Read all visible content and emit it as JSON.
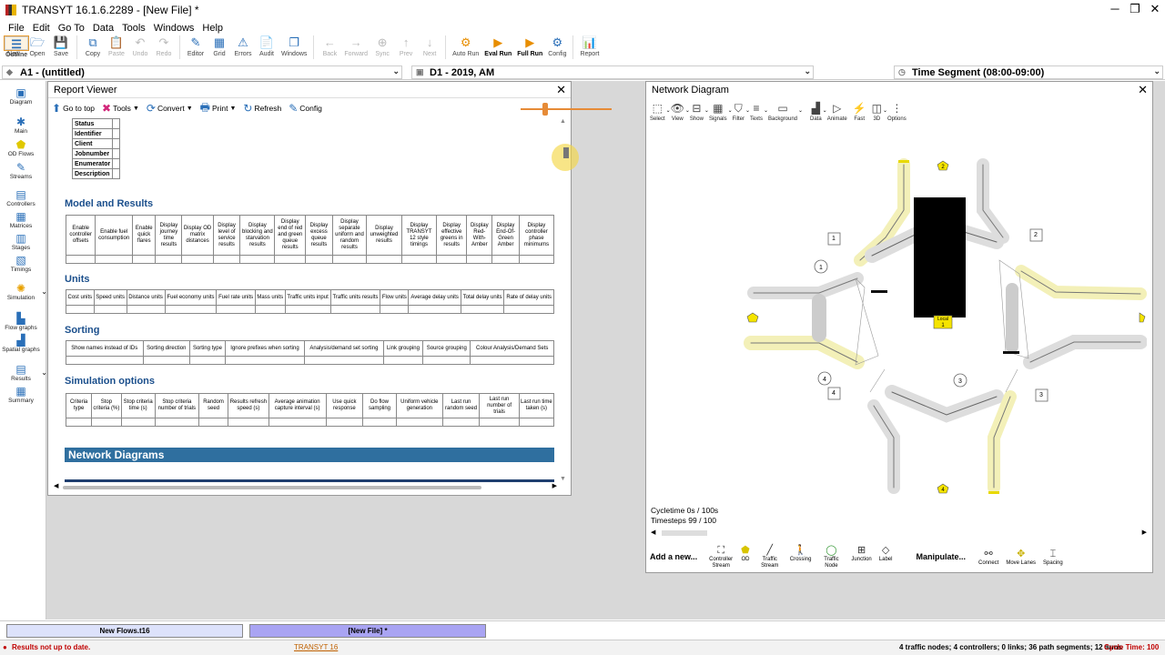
{
  "window": {
    "title": "TRANSYT 16.1.6.2289 - [New File] *"
  },
  "menu": [
    "File",
    "Edit",
    "Go To",
    "Data",
    "Tools",
    "Windows",
    "Help"
  ],
  "toolbar": [
    {
      "label": "New",
      "icon": "new-file-icon",
      "glyph": "🗋",
      "state": "normal"
    },
    {
      "label": "Open",
      "icon": "open-folder-icon",
      "glyph": "🗁",
      "state": "normal"
    },
    {
      "label": "Save",
      "icon": "save-icon",
      "glyph": "💾",
      "state": "normal"
    },
    {
      "label": "Copy",
      "icon": "copy-icon",
      "glyph": "⧉",
      "state": "normal"
    },
    {
      "label": "Paste",
      "icon": "paste-icon",
      "glyph": "📋",
      "state": "disabled"
    },
    {
      "label": "Undo",
      "icon": "undo-icon",
      "glyph": "↶",
      "state": "disabled"
    },
    {
      "label": "Redo",
      "icon": "redo-icon",
      "glyph": "↷",
      "state": "disabled"
    },
    {
      "label": "Outline",
      "icon": "outline-icon",
      "glyph": "☰",
      "state": "selected"
    },
    {
      "label": "Editor",
      "icon": "editor-icon",
      "glyph": "✎",
      "state": "normal"
    },
    {
      "label": "Grid",
      "icon": "grid-icon",
      "glyph": "▦",
      "state": "normal"
    },
    {
      "label": "Errors",
      "icon": "errors-icon",
      "glyph": "⚠",
      "state": "normal"
    },
    {
      "label": "Audit",
      "icon": "audit-icon",
      "glyph": "📄",
      "state": "normal"
    },
    {
      "label": "Windows",
      "icon": "windows-icon",
      "glyph": "❐",
      "state": "normal"
    },
    {
      "label": "Back",
      "icon": "back-arrow-icon",
      "glyph": "←",
      "state": "disabled"
    },
    {
      "label": "Forward",
      "icon": "forward-arrow-icon",
      "glyph": "→",
      "state": "disabled"
    },
    {
      "label": "Sync",
      "icon": "sync-icon",
      "glyph": "⊕",
      "state": "disabled"
    },
    {
      "label": "Prev",
      "icon": "prev-icon",
      "glyph": "↑",
      "state": "disabled"
    },
    {
      "label": "Next",
      "icon": "next-icon",
      "glyph": "↓",
      "state": "disabled"
    },
    {
      "label": "Auto Run",
      "icon": "auto-run-icon",
      "glyph": "⚙",
      "state": "normal"
    },
    {
      "label": "Eval Run",
      "icon": "eval-run-icon",
      "glyph": "▶",
      "state": "normal"
    },
    {
      "label": "Full Run",
      "icon": "full-run-icon",
      "glyph": "▶",
      "state": "normal"
    },
    {
      "label": "Config",
      "icon": "config-icon",
      "glyph": "⚙",
      "state": "normal"
    },
    {
      "label": "Report",
      "icon": "report-icon",
      "glyph": "📊",
      "state": "normal"
    }
  ],
  "selectors": {
    "analysis": "A1 - (untitled)",
    "demand": "D1 - 2019, AM",
    "time_segment": "Time Segment (08:00-09:00)"
  },
  "leftnav": [
    {
      "label": "Diagram",
      "icon": "diagram-icon",
      "glyph": "▣"
    },
    {
      "label": "Main",
      "icon": "main-icon",
      "glyph": "✱"
    },
    {
      "label": "OD Flows",
      "icon": "od-flows-icon",
      "glyph": "⬟"
    },
    {
      "label": "Streams",
      "icon": "streams-icon",
      "glyph": "✎"
    },
    {
      "label": "Controllers",
      "icon": "controllers-icon",
      "glyph": "▤"
    },
    {
      "label": "Matrices",
      "icon": "matrices-icon",
      "glyph": "▦"
    },
    {
      "label": "Stages",
      "icon": "stages-icon",
      "glyph": "▥"
    },
    {
      "label": "Timings",
      "icon": "timings-icon",
      "glyph": "▧"
    },
    {
      "label": "Simulation",
      "icon": "simulation-icon",
      "glyph": "✺"
    },
    {
      "label": "Flow graphs",
      "icon": "flow-graphs-icon",
      "glyph": "▙"
    },
    {
      "label": "Spatial graphs",
      "icon": "spatial-graphs-icon",
      "glyph": "▟"
    },
    {
      "label": "Results",
      "icon": "results-icon",
      "glyph": "▤"
    },
    {
      "label": "Summary",
      "icon": "summary-icon",
      "glyph": "▦"
    }
  ],
  "report_viewer": {
    "title": "Report Viewer",
    "tools": [
      {
        "label": "Go to top",
        "icon": "go-to-top-icon",
        "glyph": "⬆",
        "dropdown": false
      },
      {
        "label": "Tools",
        "icon": "tools-icon",
        "glyph": "✖",
        "dropdown": true
      },
      {
        "label": "Convert",
        "icon": "convert-icon",
        "glyph": "⟳",
        "dropdown": true
      },
      {
        "label": "Print",
        "icon": "print-icon",
        "glyph": "🖶",
        "dropdown": true
      },
      {
        "label": "Refresh",
        "icon": "refresh-icon",
        "glyph": "↻",
        "dropdown": false
      },
      {
        "label": "Config",
        "icon": "config-icon",
        "glyph": "✎",
        "dropdown": false
      }
    ],
    "status_rows": [
      "Status",
      "Identifier",
      "Client",
      "Jobnumber",
      "Enumerator",
      "Description"
    ],
    "model_results": {
      "heading": "Model and Results",
      "columns": [
        "Enable controller offsets",
        "Enable fuel consumption",
        "Enable quick flares",
        "Display journey time results",
        "Display OD matrix distances",
        "Display level of service results",
        "Display blocking and starvation results",
        "Display end of red and green queue results",
        "Display excess queue results",
        "Display separate uniform and random results",
        "Display unweighted results",
        "Display TRANSYT 12 style timings",
        "Display effective greens in results",
        "Display Red-With-Amber",
        "Display End-Of-Green Amber",
        "Display controller phase minimums"
      ]
    },
    "units": {
      "heading": "Units",
      "columns": [
        "Cost units",
        "Speed units",
        "Distance units",
        "Fuel economy units",
        "Fuel rate units",
        "Mass units",
        "Traffic units input",
        "Traffic units results",
        "Flow units",
        "Average delay units",
        "Total delay units",
        "Rate of delay units"
      ]
    },
    "sorting": {
      "heading": "Sorting",
      "columns": [
        "Show names instead of IDs",
        "Sorting direction",
        "Sorting type",
        "Ignore prefixes when sorting",
        "Analysis/demand set sorting",
        "Link grouping",
        "Source grouping",
        "Colour Analysis/Demand Sets"
      ]
    },
    "simulation": {
      "heading": "Simulation options",
      "columns": [
        "Criteria type",
        "Stop criteria (%)",
        "Stop criteria time (s)",
        "Stop criteria number of trials",
        "Random seed",
        "Results refresh speed (s)",
        "Average animation capture interval (s)",
        "Use quick response",
        "Do flow sampling",
        "Uniform vehicle generation",
        "Last run random seed",
        "Last run number of trials",
        "Last run time taken (s)"
      ]
    },
    "network_band": "Network Diagrams",
    "zoom_level": 0.27
  },
  "network_diagram": {
    "title": "Network Diagram",
    "tools": [
      {
        "label": "Select",
        "icon": "select-icon",
        "glyph": "⬚"
      },
      {
        "label": "View",
        "icon": "view-icon",
        "glyph": "👁"
      },
      {
        "label": "Show",
        "icon": "show-icon",
        "glyph": "⊟"
      },
      {
        "label": "Signals",
        "icon": "signals-icon",
        "glyph": "▦"
      },
      {
        "label": "Filter",
        "icon": "filter-icon",
        "glyph": "⛉"
      },
      {
        "label": "Texts",
        "icon": "texts-icon",
        "glyph": "≡"
      },
      {
        "label": "Background",
        "icon": "background-icon",
        "glyph": "▭"
      },
      {
        "label": "Data",
        "icon": "data-icon",
        "glyph": "▟"
      },
      {
        "label": "Animate",
        "icon": "animate-icon",
        "glyph": "▷"
      },
      {
        "label": "Fast",
        "icon": "fast-icon",
        "glyph": "⚡"
      },
      {
        "label": "3D",
        "icon": "3d-icon",
        "glyph": "◫"
      },
      {
        "label": "Options",
        "icon": "options-icon",
        "glyph": "⋮"
      }
    ],
    "labels": {
      "node_1": "1",
      "node_2": "2",
      "node_3": "3",
      "node_4": "4",
      "od_2": "2",
      "od_4": "4",
      "local": "Local",
      "local_num": "1"
    },
    "cycletime": "Cycletime 0s / 100s",
    "timesteps": "Timesteps 99 / 100",
    "add_label": "Add a new...",
    "add_tools": [
      {
        "label": "Controller Stream",
        "icon": "controller-stream-icon",
        "glyph": "⛶"
      },
      {
        "label": "OD",
        "icon": "od-icon",
        "glyph": "⬟"
      },
      {
        "label": "Traffic Stream",
        "icon": "traffic-stream-icon",
        "glyph": "╱"
      },
      {
        "label": "Crossing",
        "icon": "crossing-icon",
        "glyph": "🚶"
      },
      {
        "label": "Traffic Node",
        "icon": "traffic-node-icon",
        "glyph": "◯"
      },
      {
        "label": "Junction",
        "icon": "junction-icon",
        "glyph": "⊞"
      },
      {
        "label": "Label",
        "icon": "label-icon",
        "glyph": "◇"
      }
    ],
    "manipulate_label": "Manipulate...",
    "manip_tools": [
      {
        "label": "Connect",
        "icon": "connect-icon",
        "glyph": "⚯"
      },
      {
        "label": "Move Lanes",
        "icon": "move-lanes-icon",
        "glyph": "✥"
      },
      {
        "label": "Spacing",
        "icon": "spacing-icon",
        "glyph": "⌶"
      }
    ]
  },
  "bottom_tabs": [
    "New Flows.t16",
    "[New File] *"
  ],
  "status": {
    "warning": "Results not up to date.",
    "app_link": "TRANSYT 16",
    "summary": "4 traffic nodes; 4 controllers; 0 links; 36 path segments; 12 arms",
    "cycle_time": "Cycle Time: 100"
  },
  "colors": {
    "accent": "#e68b37",
    "band": "#2f6f9f",
    "heading": "#1b4f8c",
    "warning": "#c00000",
    "tab_active": "#c8c8f8"
  }
}
